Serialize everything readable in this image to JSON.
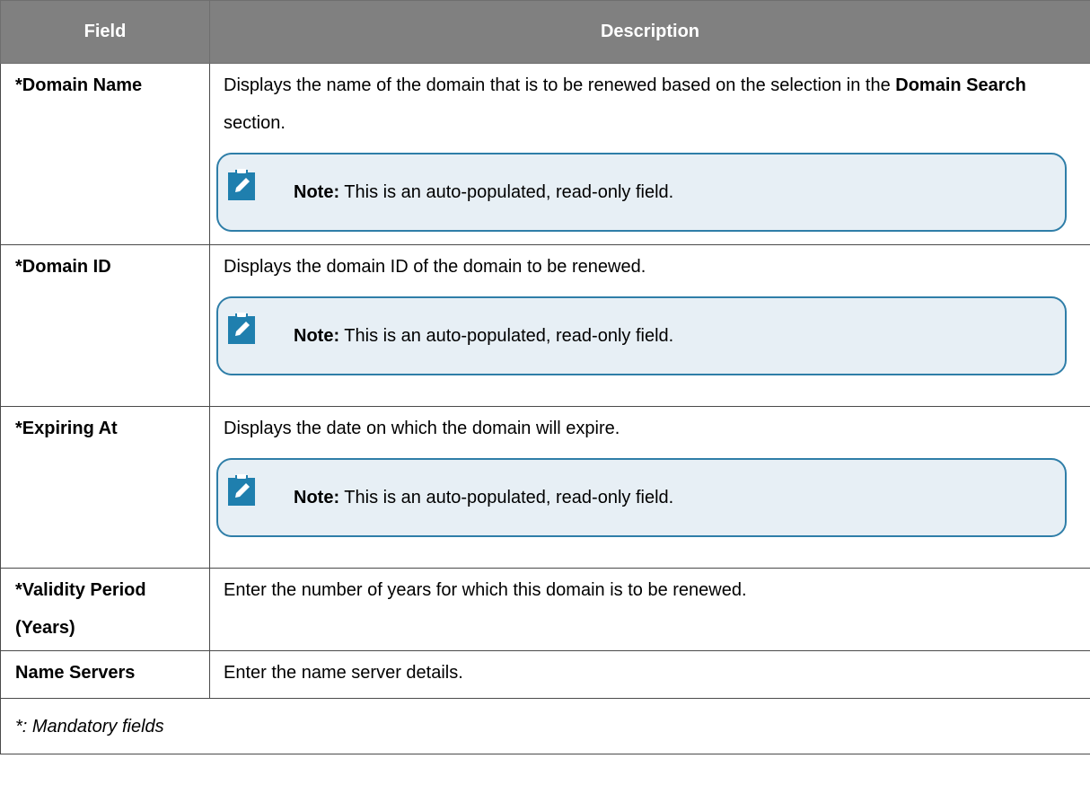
{
  "table": {
    "headers": {
      "field": "Field",
      "description": "Description"
    },
    "rows": [
      {
        "field": "*Domain Name",
        "description_before": "Displays the name of the domain that is to be renewed based on the selection in the ",
        "description_bold": "Domain Search",
        "description_after": " section.",
        "note_label": "Note:",
        "note_text": " This is an auto-populated, read-only field."
      },
      {
        "field": "*Domain ID",
        "description": "Displays the domain ID of the domain to be renewed.",
        "note_label": "Note:",
        "note_text": " This is an auto-populated, read-only field."
      },
      {
        "field": "*Expiring At",
        "description": "Displays the date on which the domain will expire.",
        "note_label": "Note:",
        "note_text": " This is an auto-populated, read-only field."
      },
      {
        "field": "*Validity Period (Years)",
        "description": "Enter the number of years for which this domain is to be renewed."
      },
      {
        "field": "Name Servers",
        "description": "Enter the name server details."
      }
    ],
    "footnote": "*: Mandatory fields"
  },
  "icons": {
    "note": "note-pencil-clipboard-icon"
  },
  "colors": {
    "header_bg": "#808080",
    "header_text": "#ffffff",
    "note_border": "#2f7ea8",
    "note_bg": "#e7eff5",
    "note_icon": "#1f7fae"
  }
}
